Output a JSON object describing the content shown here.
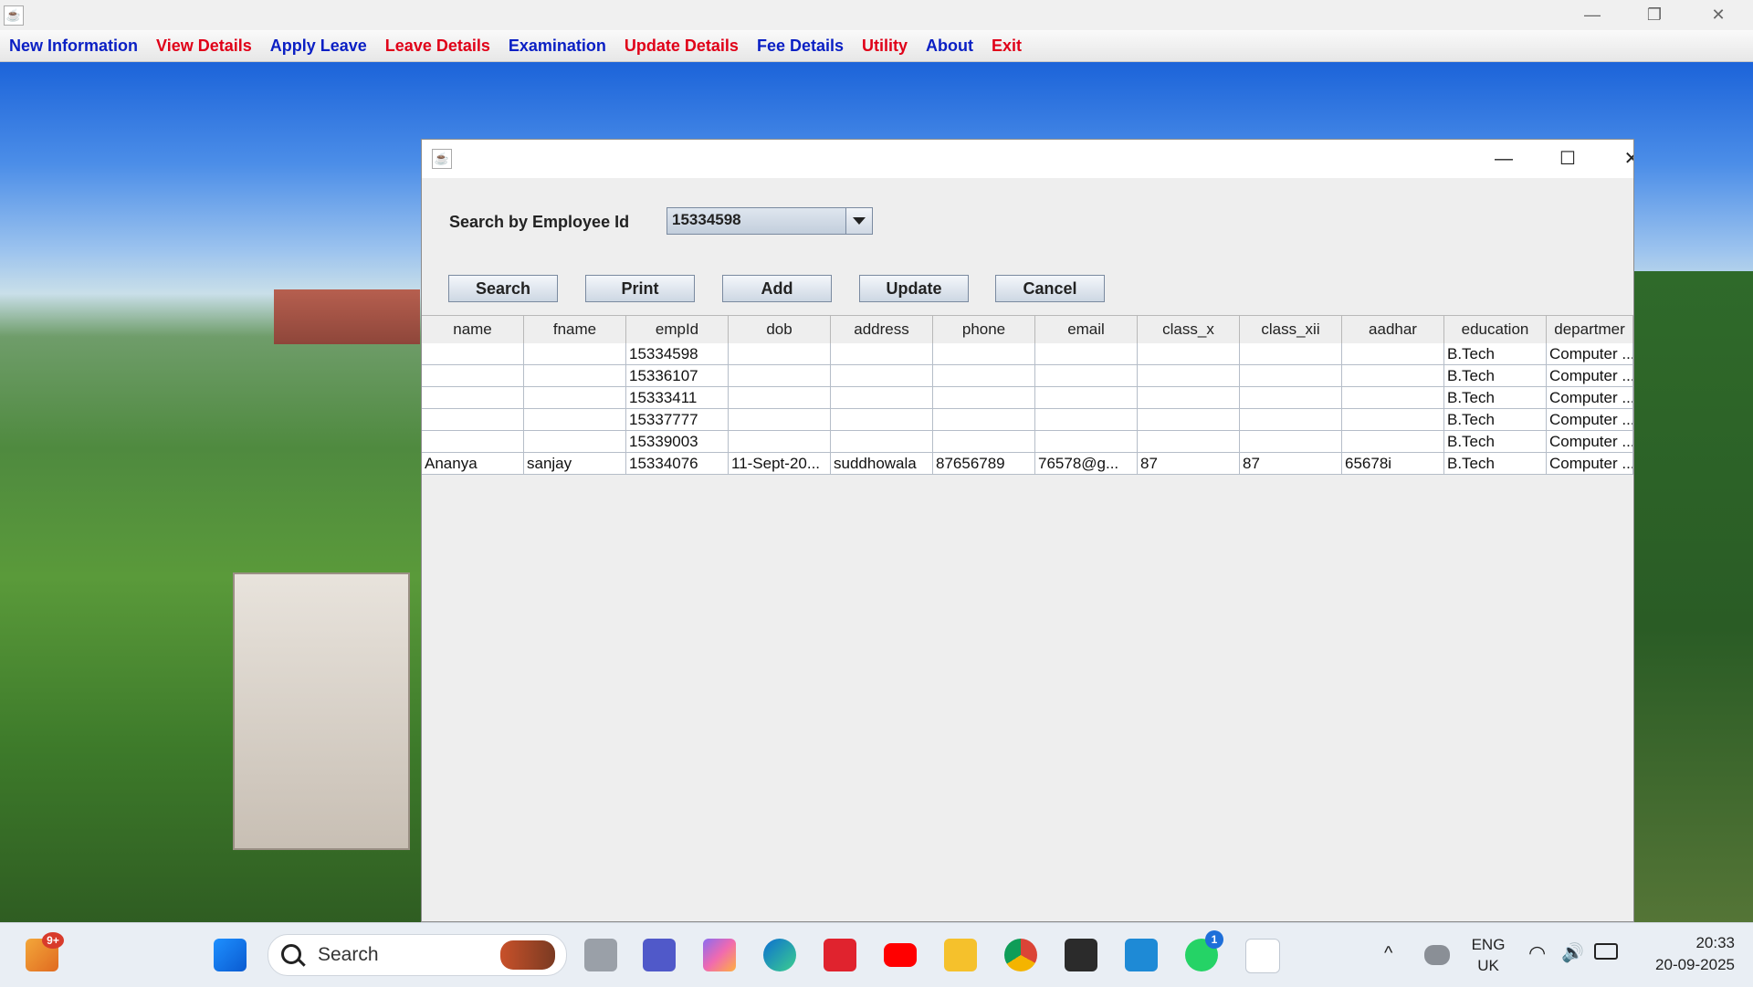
{
  "window": {
    "minimize_glyph": "—",
    "restore_glyph": "❐",
    "close_glyph": "✕"
  },
  "menu": [
    {
      "label": "New Information",
      "color": "#0a1fc4"
    },
    {
      "label": "View Details",
      "color": "#e00018"
    },
    {
      "label": "Apply Leave",
      "color": "#0a1fc4"
    },
    {
      "label": "Leave Details",
      "color": "#e00018"
    },
    {
      "label": "Examination",
      "color": "#0a1fc4"
    },
    {
      "label": "Update Details",
      "color": "#e00018"
    },
    {
      "label": "Fee Details",
      "color": "#0a1fc4"
    },
    {
      "label": "Utility",
      "color": "#e00018"
    },
    {
      "label": "About",
      "color": "#0a1fc4"
    },
    {
      "label": "Exit",
      "color": "#e00018"
    }
  ],
  "dialog": {
    "search_label": "Search by Employee Id",
    "employee_id_value": "15334598",
    "buttons": {
      "search": "Search",
      "print": "Print",
      "add": "Add",
      "update": "Update",
      "cancel": "Cancel"
    },
    "table": {
      "columns": [
        "name",
        "fname",
        "empId",
        "dob",
        "address",
        "phone",
        "email",
        "class_x",
        "class_xii",
        "aadhar",
        "education",
        "departmer"
      ],
      "rows": [
        [
          "",
          "",
          "15334598",
          "",
          "",
          "",
          "",
          "",
          "",
          "",
          "B.Tech",
          "Computer ..."
        ],
        [
          "",
          "",
          "15336107",
          "",
          "",
          "",
          "",
          "",
          "",
          "",
          "B.Tech",
          "Computer ..."
        ],
        [
          "",
          "",
          "15333411",
          "",
          "",
          "",
          "",
          "",
          "",
          "",
          "B.Tech",
          "Computer ..."
        ],
        [
          "",
          "",
          "15337777",
          "",
          "",
          "",
          "",
          "",
          "",
          "",
          "B.Tech",
          "Computer ..."
        ],
        [
          "",
          "",
          "15339003",
          "",
          "",
          "",
          "",
          "",
          "",
          "",
          "B.Tech",
          "Computer ..."
        ],
        [
          "Ananya",
          "sanjay",
          "15334076",
          "11-Sept-20...",
          "suddhowala",
          "87656789",
          "76578@g...",
          "87",
          "87",
          "65678i",
          "B.Tech",
          "Computer ..."
        ]
      ]
    }
  },
  "taskbar": {
    "search_placeholder": "Search",
    "widgets_badge": "9+",
    "teams_badge": "1",
    "language_line1": "ENG",
    "language_line2": "UK",
    "time": "20:33",
    "date": "20-09-2025"
  }
}
